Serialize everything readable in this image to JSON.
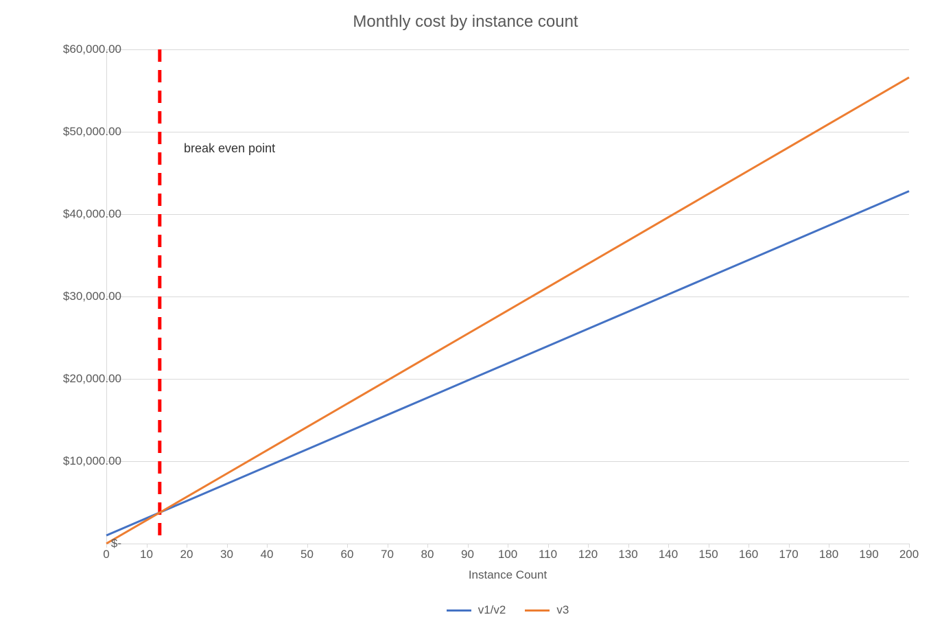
{
  "chart_data": {
    "type": "line",
    "title": "Monthly cost by instance count",
    "xlabel": "Instance Count",
    "ylabel": "",
    "x": [
      0,
      10,
      20,
      30,
      40,
      50,
      60,
      70,
      80,
      90,
      100,
      110,
      120,
      130,
      140,
      150,
      160,
      170,
      180,
      190,
      200
    ],
    "x_ticks": [
      0,
      10,
      20,
      30,
      40,
      50,
      60,
      70,
      80,
      90,
      100,
      110,
      120,
      130,
      140,
      150,
      160,
      170,
      180,
      190,
      200
    ],
    "y_ticks": [
      0,
      10000,
      20000,
      30000,
      40000,
      50000,
      60000
    ],
    "y_tick_labels": [
      "$-",
      "$10,000.00",
      "$20,000.00",
      "$30,000.00",
      "$40,000.00",
      "$50,000.00",
      "$60,000.00"
    ],
    "xlim": [
      0,
      200
    ],
    "ylim": [
      0,
      60000
    ],
    "series": [
      {
        "name": "v1/v2",
        "color": "#4472C4",
        "values": [
          990,
          3080,
          5170,
          7260,
          9350,
          11440,
          13530,
          15620,
          17710,
          19800,
          21890,
          23980,
          26070,
          28160,
          30250,
          32340,
          34430,
          36520,
          38610,
          40700,
          42790
        ]
      },
      {
        "name": "v3",
        "color": "#ED7D31",
        "values": [
          0,
          2830,
          5660,
          8490,
          11320,
          14150,
          16980,
          19810,
          22640,
          25470,
          28300,
          31130,
          33960,
          36790,
          39620,
          42450,
          45280,
          48110,
          50940,
          53770,
          56600
        ]
      }
    ],
    "annotations": [
      {
        "type": "vline",
        "x": 13.3,
        "color": "#FF0000",
        "style": "dashed",
        "label": "break even point"
      }
    ],
    "legend_position": "bottom",
    "grid": "horizontal"
  }
}
